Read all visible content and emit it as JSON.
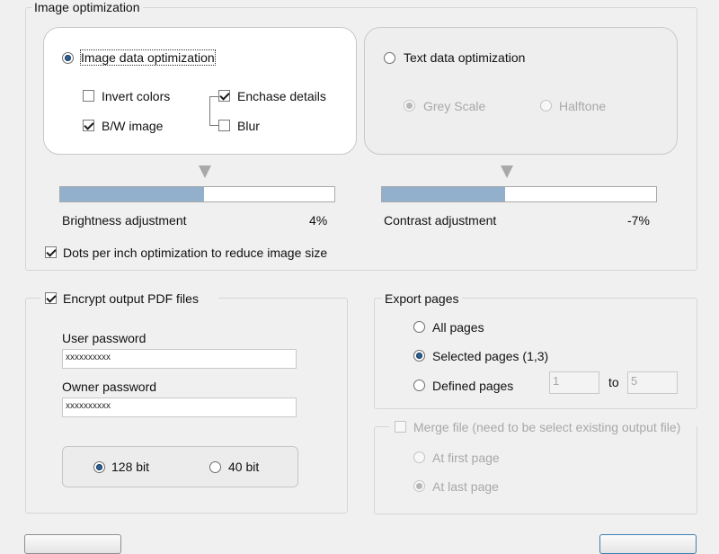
{
  "image_optimization": {
    "legend": "Image optimization",
    "image_data": {
      "label": "Image data optimization",
      "invert_colors": "Invert colors",
      "bw_image": "B/W image",
      "enhance_details": "Enchase details",
      "blur": "Blur"
    },
    "text_data": {
      "label": "Text data optimization",
      "grey_scale": "Grey Scale",
      "halftone": "Halftone"
    },
    "brightness": {
      "label": "Brightness adjustment",
      "value_text": "4%",
      "fill_fraction": 0.525
    },
    "contrast": {
      "label": "Contrast adjustment",
      "value_text": "-7%",
      "fill_fraction": 0.45
    },
    "dpi_label": "Dots per inch optimization to reduce image size"
  },
  "encryption": {
    "label": "Encrypt output PDF files",
    "user_password_label": "User password",
    "user_password_value": "xxxxxxxxxx",
    "owner_password_label": "Owner password",
    "owner_password_value": "xxxxxxxxxx",
    "bit128": "128 bit",
    "bit40": "40 bit"
  },
  "export_pages": {
    "legend": "Export pages",
    "all_pages": "All pages",
    "selected_pages": "Selected pages (1,3)",
    "defined_pages": "Defined pages",
    "from_value": "1",
    "to_label": "to",
    "to_value": "5"
  },
  "merge": {
    "label": "Merge file (need to be select existing output file)",
    "at_first": "At first page",
    "at_last": "At last page"
  },
  "colors": {
    "slider_fill": "#92b0cc",
    "radio_selected": "#2d5f8f",
    "window_bg": "#f0f0f0"
  }
}
